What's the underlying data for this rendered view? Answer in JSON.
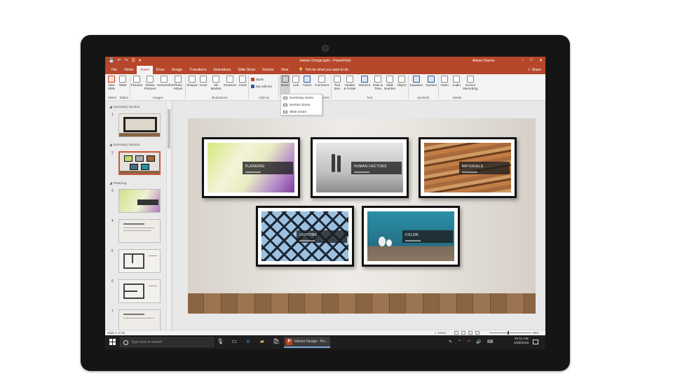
{
  "window": {
    "title": "Interior Design.pptx - PowerPoint",
    "user": "Aimee Owens",
    "share_label": "Share",
    "min": "−",
    "max": "□",
    "close": "✕",
    "qat": [
      "💾",
      "↶",
      "↷",
      "☰",
      "▾"
    ]
  },
  "tabs": [
    "File",
    "Home",
    "Insert",
    "Draw",
    "Design",
    "Transitions",
    "Animations",
    "Slide Show",
    "Review",
    "View"
  ],
  "active_tab": "Insert",
  "tell_me": "Tell me what you want to do",
  "ribbon": {
    "new_slide": [
      "New",
      "Slide"
    ],
    "table": [
      "Table"
    ],
    "pictures": [
      "Pictures"
    ],
    "online_pictures": [
      "Online",
      "Pictures"
    ],
    "screenshot": [
      "Screenshot"
    ],
    "photo_album": [
      "Photo",
      "Album"
    ],
    "shapes": [
      "Shapes"
    ],
    "icons": [
      "Icons"
    ],
    "models_3d": [
      "3D",
      "Models"
    ],
    "smartart": [
      "SmartArt"
    ],
    "chart": [
      "Chart"
    ],
    "store": "Store",
    "my_addins": "My Add-ins",
    "zoom": [
      "Zoom"
    ],
    "link": [
      "Link"
    ],
    "action": [
      "Action"
    ],
    "comment": [
      "Comment"
    ],
    "text_box": [
      "Text",
      "Box"
    ],
    "header_footer": [
      "Header",
      "& Footer"
    ],
    "wordart": [
      "WordArt"
    ],
    "date_time": [
      "Date &",
      "Time"
    ],
    "slide_number": [
      "Slide",
      "Number"
    ],
    "object": [
      "Object"
    ],
    "equation": [
      "Equation"
    ],
    "symbol": [
      "Symbol"
    ],
    "video": [
      "Video"
    ],
    "audio": [
      "Audio"
    ],
    "screen_recording": [
      "Screen",
      "Recording"
    ],
    "groups": {
      "slides": "Slides",
      "tables": "Tables",
      "images": "Images",
      "illustrations": "Illustrations",
      "addins": "Add-ins",
      "comments": "Comments",
      "text": "Text",
      "symbols": "Symbols",
      "media": "Media"
    }
  },
  "zoom_menu": [
    "Summary Zoom",
    "Section Zoom",
    "Slide Zoom"
  ],
  "thumbnails": {
    "sections": [
      {
        "label": "Summary Section"
      },
      {
        "label": "Summary Section"
      },
      {
        "label": "Planning"
      }
    ],
    "numbers": [
      "1",
      "2",
      "3",
      "4",
      "5",
      "6",
      "7"
    ]
  },
  "slide": {
    "frames": [
      {
        "label": "PLANNING"
      },
      {
        "label": "HUMAN FACTORS"
      },
      {
        "label": "MATERIALS"
      },
      {
        "label": "LIGHTING"
      },
      {
        "label": "COLOR"
      }
    ]
  },
  "status": {
    "slide_count": "Slide 2 of 39",
    "notes": "Notes",
    "zoom": "89%"
  },
  "taskbar": {
    "search_placeholder": "Type here to search",
    "app_label": "Interior Design - Po...",
    "time": "10:11 AM",
    "date": "4/30/2018"
  },
  "colors": {
    "accent": "#b7472a",
    "taskbar": "#1e1e1e"
  }
}
